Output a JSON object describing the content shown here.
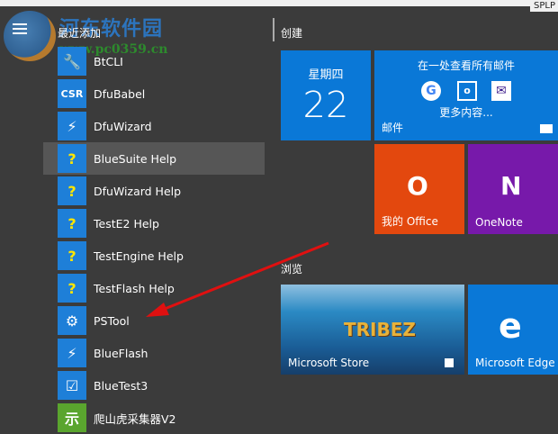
{
  "topbar": {
    "text": "SPLP"
  },
  "watermark": {
    "title": "河东软件园",
    "url": "www.pc0359.cn"
  },
  "left": {
    "section": "最近添加",
    "items": [
      {
        "label": "BtCLI",
        "icon": "wrench-icon",
        "glyph": "🔧"
      },
      {
        "label": "DfuBabel",
        "icon": "csr-icon",
        "glyph": "CSR"
      },
      {
        "label": "DfuWizard",
        "icon": "wizard-icon",
        "glyph": "⚡"
      },
      {
        "label": "BlueSuite Help",
        "icon": "help-icon",
        "glyph": "?"
      },
      {
        "label": "DfuWizard Help",
        "icon": "help-icon",
        "glyph": "?"
      },
      {
        "label": "TestE2 Help",
        "icon": "help-icon",
        "glyph": "?"
      },
      {
        "label": "TestEngine Help",
        "icon": "help-icon",
        "glyph": "?"
      },
      {
        "label": "TestFlash Help",
        "icon": "help-icon",
        "glyph": "?"
      },
      {
        "label": "PSTool",
        "icon": "gears-icon",
        "glyph": "⚙"
      },
      {
        "label": "BlueFlash",
        "icon": "flash-icon",
        "glyph": "⚡"
      },
      {
        "label": "BlueTest3",
        "icon": "checkbox-icon",
        "glyph": "☑"
      },
      {
        "label": "爬山虎采集器V2",
        "icon": "app-icon",
        "glyph": "示"
      }
    ]
  },
  "tiles": {
    "group1": "创建",
    "calendar": {
      "day": "星期四",
      "date": "22"
    },
    "mail": {
      "headline": "在一处查看所有邮件",
      "more": "更多内容...",
      "name": "邮件",
      "g": "G",
      "o": "o",
      "m": "✉"
    },
    "office": {
      "name": "我的 Office",
      "glyph": "O"
    },
    "onenote": {
      "name": "OneNote",
      "glyph": "N"
    },
    "group2": "浏览",
    "store": {
      "name": "Microsoft Store",
      "art": "TRIBEZ"
    },
    "edge": {
      "name": "Microsoft Edge",
      "glyph": "e"
    }
  },
  "colors": {
    "tile_blue": "#0a78d7",
    "office": "#e3480e",
    "onenote": "#7719aa",
    "arrow": "#e01010"
  }
}
